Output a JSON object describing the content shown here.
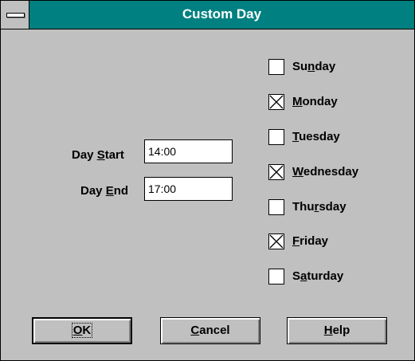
{
  "window": {
    "title": "Custom Day"
  },
  "fields": {
    "day_start": {
      "label_pre": "Day ",
      "label_key": "S",
      "label_post": "tart",
      "value": "14:00"
    },
    "day_end": {
      "label_pre": "Day ",
      "label_key": "E",
      "label_post": "nd",
      "value": "17:00"
    }
  },
  "days": [
    {
      "pre": "Su",
      "key": "n",
      "post": "day",
      "checked": false
    },
    {
      "pre": "",
      "key": "M",
      "post": "onday",
      "checked": true
    },
    {
      "pre": "",
      "key": "T",
      "post": "uesday",
      "checked": false
    },
    {
      "pre": "",
      "key": "W",
      "post": "ednesday",
      "checked": true
    },
    {
      "pre": "Thu",
      "key": "r",
      "post": "sday",
      "checked": false
    },
    {
      "pre": "",
      "key": "F",
      "post": "riday",
      "checked": true
    },
    {
      "pre": "S",
      "key": "a",
      "post": "turday",
      "checked": false
    }
  ],
  "buttons": {
    "ok": {
      "pre": "",
      "key": "O",
      "post": "K"
    },
    "cancel": {
      "pre": "",
      "key": "C",
      "post": "ancel"
    },
    "help": {
      "pre": "",
      "key": "H",
      "post": "elp"
    }
  },
  "colors": {
    "titlebar": "#008080",
    "face": "#c0c0c0"
  }
}
